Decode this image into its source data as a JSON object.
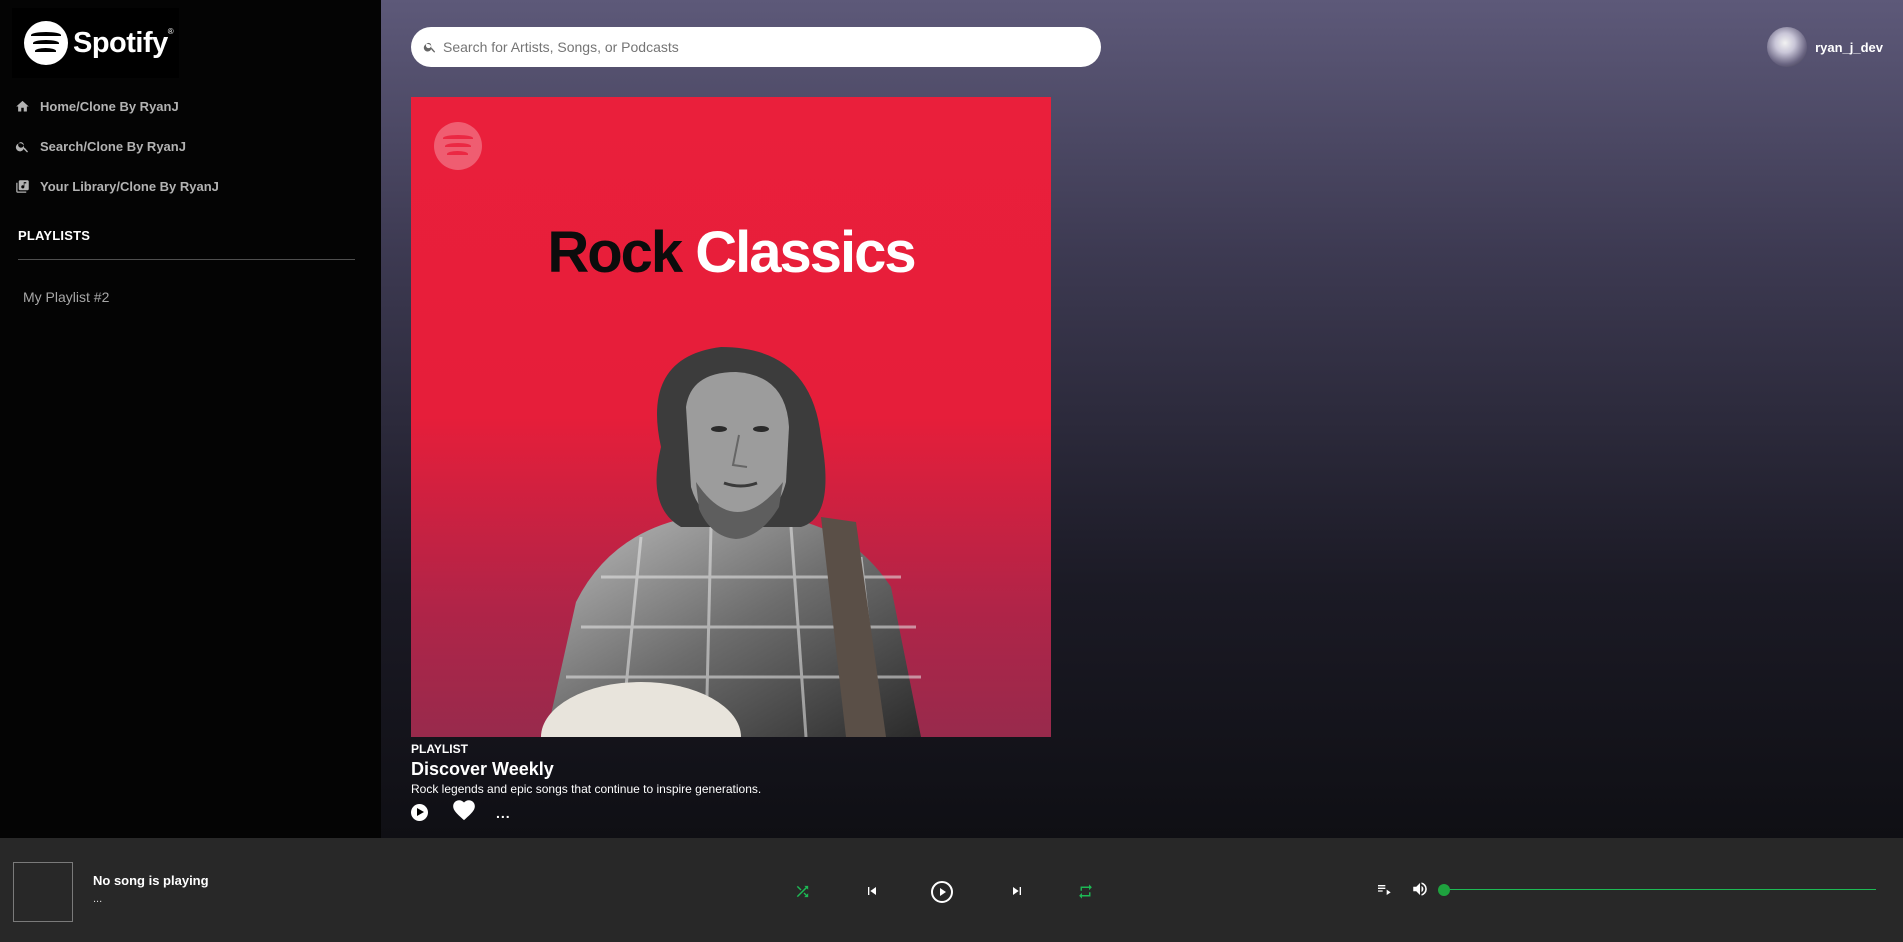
{
  "brand": {
    "name": "Spotify"
  },
  "sidebar": {
    "nav": [
      {
        "label": "Home/Clone By RyanJ",
        "icon": "home-icon"
      },
      {
        "label": "Search/Clone By RyanJ",
        "icon": "search-icon"
      },
      {
        "label": "Your Library/Clone By RyanJ",
        "icon": "library-icon"
      }
    ],
    "playlists_title": "PLAYLISTS",
    "playlists": [
      "My Playlist #2"
    ]
  },
  "header": {
    "search_placeholder": "Search for Artists, Songs, or Podcasts",
    "username": "ryan_j_dev"
  },
  "playlist": {
    "cover_title_dark": "Rock",
    "cover_title_light": "Classics",
    "type": "PLAYLIST",
    "title": "Discover Weekly",
    "description": "Rock legends and epic songs that continue to inspire generations.",
    "more_label": "..."
  },
  "player": {
    "now_playing_title": "No song is playing",
    "now_playing_artist": "...",
    "volume": 0,
    "accent_color": "#1db954"
  }
}
